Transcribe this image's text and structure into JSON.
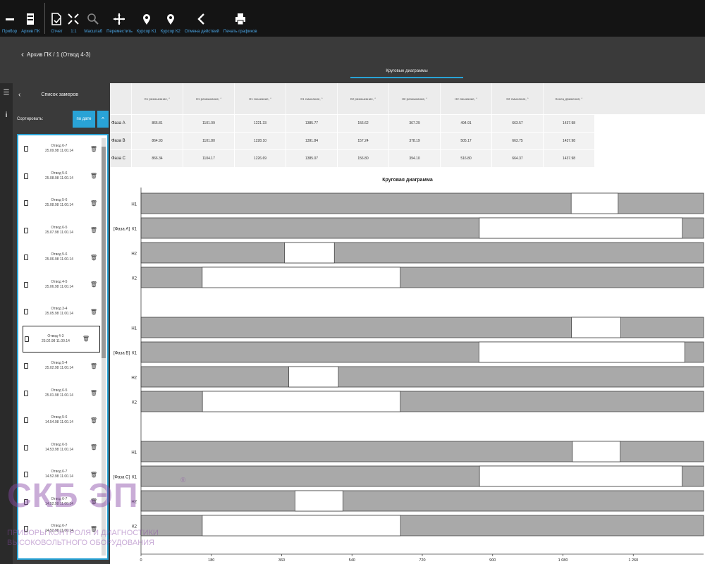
{
  "toolbar": {
    "buttons": [
      {
        "label": "Прибор",
        "icon": "minus-icon"
      },
      {
        "label": "Архив ПК",
        "icon": "archive-icon"
      },
      {
        "label": "Отчет",
        "icon": "report-icon"
      },
      {
        "label": "1:1",
        "icon": "actual-size-icon"
      },
      {
        "label": "Масштаб",
        "icon": "zoom-icon"
      },
      {
        "label": "Переместить",
        "icon": "move-icon"
      },
      {
        "label": "Курсор К1",
        "icon": "cursor-pin-icon"
      },
      {
        "label": "Курсор К2",
        "icon": "cursor-pin-icon"
      },
      {
        "label": "Отмена действий",
        "icon": "undo-chevron-icon"
      },
      {
        "label": "Печать графиков",
        "icon": "printer-icon"
      }
    ]
  },
  "header": {
    "breadcrumb": "Архив ПК / 1 (Отвод 4-3)",
    "tab": "Круговые диаграммы"
  },
  "side_panel": {
    "title": "Список замеров",
    "sort_label": "Сортировать:",
    "sort_button": "по дате",
    "items": [
      {
        "name": "Отвод 6-7",
        "date": "25.09.98 11.00.14"
      },
      {
        "name": "Отвод 5-6",
        "date": "25.08.98 11.00.14"
      },
      {
        "name": "Отвод 5-6",
        "date": "25.08.98 11.00.14"
      },
      {
        "name": "Отвод 6-5",
        "date": "25.07.98 11.00.14"
      },
      {
        "name": "Отвод 5-6",
        "date": "25.06.98 11.00.14"
      },
      {
        "name": "Отвод 4-5",
        "date": "25.06.98 11.00.14"
      },
      {
        "name": "Отвод 3-4",
        "date": "25.05.98 11.00.14"
      },
      {
        "name": "Отвод 4-3",
        "date": "25.02.98 11.00.14",
        "selected": true
      },
      {
        "name": "Отвод 5-4",
        "date": "25.02.98 11.00.14"
      },
      {
        "name": "Отвод 6-5",
        "date": "25.01.98 11.00.14"
      },
      {
        "name": "Отвод 5-6",
        "date": "14.54.98 11.00.14"
      },
      {
        "name": "Отвод 6-5",
        "date": "14.53.98 11.00.14"
      },
      {
        "name": "Отвод 6-7",
        "date": "14.52.98 11.00.14"
      },
      {
        "name": "Отвод 6-7",
        "date": "14.52.98 11.00.14"
      },
      {
        "name": "Отвод 6-7",
        "date": "14.52.98 11.00.14"
      }
    ]
  },
  "table": {
    "columns": [
      "К1 размыкание, °",
      "Н1 размыкание, °",
      "Н1 смыкание, °",
      "К1 смыкание, °",
      "К2 размыкание, °",
      "Н2 размыкание, °",
      "Н2 смыкание, °",
      "К2 смыкание, °",
      "Конец движения, °"
    ],
    "rows": [
      {
        "label": "Фаза А",
        "values": [
          "865.81",
          "1101.09",
          "1221.33",
          "1385.77",
          "156.62",
          "367.29",
          "494.91",
          "663.57",
          "1437.98"
        ]
      },
      {
        "label": "Фаза В",
        "values": [
          "864.93",
          "1101.80",
          "1228.10",
          "1391.84",
          "157.24",
          "378.19",
          "505.17",
          "663.75",
          "1437.98"
        ]
      },
      {
        "label": "Фаза С",
        "values": [
          "866.34",
          "1104.17",
          "1226.69",
          "1385.07",
          "156.80",
          "394.10",
          "516.80",
          "664.37",
          "1437.98"
        ]
      }
    ]
  },
  "chart_data": {
    "type": "bar",
    "title": "Круговая диаграмма",
    "xlim": [
      0,
      1440
    ],
    "xticks": [
      "0",
      "180",
      "360",
      "540",
      "720",
      "900",
      "1 080",
      "1 260"
    ],
    "xtick_values": [
      0,
      180,
      360,
      540,
      720,
      900,
      1080,
      1260
    ],
    "groups": [
      {
        "label": "Фаза А",
        "rows": [
          {
            "label": "Н1",
            "open": [
              1101.09,
              1221.33
            ]
          },
          {
            "label": "К1",
            "open": [
              865.81,
              1385.77
            ]
          },
          {
            "label": "Н2",
            "open": [
              367.29,
              494.91
            ]
          },
          {
            "label": "К2",
            "open": [
              156.62,
              663.57
            ]
          }
        ]
      },
      {
        "label": "Фаза В",
        "rows": [
          {
            "label": "Н1",
            "open": [
              1101.8,
              1228.1
            ]
          },
          {
            "label": "К1",
            "open": [
              864.93,
              1391.84
            ]
          },
          {
            "label": "Н2",
            "open": [
              378.19,
              505.17
            ]
          },
          {
            "label": "К2",
            "open": [
              157.24,
              663.75
            ]
          }
        ]
      },
      {
        "label": "Фаза С",
        "rows": [
          {
            "label": "Н1",
            "open": [
              1104.17,
              1226.69
            ]
          },
          {
            "label": "К1",
            "open": [
              866.34,
              1385.07
            ]
          },
          {
            "label": "Н2",
            "open": [
              394.1,
              516.8
            ]
          },
          {
            "label": "К2",
            "open": [
              156.8,
              664.37
            ]
          }
        ]
      }
    ],
    "colors": {
      "closed": "#a9a9a9",
      "open": "#ffffff",
      "border": "#444444"
    }
  },
  "watermark": {
    "logo": "СКБ ЭП",
    "reg": "®",
    "line1": "ПРИБОРЫ КОНТРОЛЯ И ДИАГНОСТИКИ",
    "line2": "ВЫСОКОВОЛЬТНОГО ОБОРУДОВАНИЯ"
  }
}
